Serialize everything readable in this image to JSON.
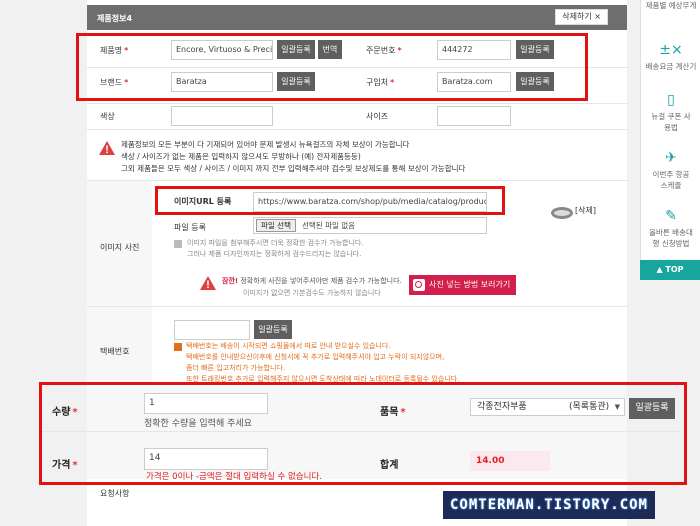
{
  "section": {
    "title": "제품정보4",
    "delete_label": "삭제하기"
  },
  "product": {
    "name_label": "제품명",
    "name_value": "Encore, Virtuoso & Preciso r",
    "bulk_btn": "일괄등록",
    "translate_btn": "번역",
    "order_no_label": "주문번호",
    "order_no_value": "444272",
    "brand_label": "브랜드",
    "brand_value": "Baratza",
    "shop_label": "구입처",
    "shop_value": "Baratza.com",
    "color_label": "색상",
    "size_label": "사이즈"
  },
  "notice": {
    "line1": "제품정보의 모든 부분이 다 기재되어 있어야 문제 발생시 뉴욕걸즈의 자체 보상이 가능합니다",
    "line2": "색상 / 사이즈가 없는 제품은 입력하지 않으셔도 무방하나 (예) 전자제품등등)",
    "line3": "그외 제품들은 모두 색상 / 사이즈 / 이미지 까지 전부 입력해주셔야 검수및 보상제도를 통해 보상이 가능합니다"
  },
  "image": {
    "section_label": "이미지 사진",
    "url_label": "이미지URL 등록",
    "url_value": "https://www.baratza.com/shop/pub/media/catalog/product/ca",
    "file_label": "파일 등록",
    "file_btn": "파일 선택",
    "file_status": "선택된 파일 없음",
    "delete_link": "[삭제]",
    "hint1": "이미지 파일을 첨부해주시면 더욱 정확한 검수가 가능합니다.",
    "hint2": "그러나 제품 디자인까지는 정확하게 검수드리지는 않습니다.",
    "warn_bold": "잠깐!",
    "warn1": "정확하게 사진을 넣어주셔야만 제품 검수가 가능합니다.",
    "warn2": "이미지가 없으면 기본검수도 가능하지 않습니다",
    "how_btn": "사진 넣는 방법 보러가기"
  },
  "tracking": {
    "label": "택배번호",
    "bulk_btn": "일괄등록",
    "lines": [
      "택배번호는 배송이 시작되면 쇼핑몰에서 따로 안내 받으실수 있습니다.",
      "택배번호를 안내받으신이후에 신청서에 꼭 추가로 입력해주셔야 입고 누락이 되지않으며,",
      "좀더 빠른 입고처리가 가능합니다.",
      "또한 트래킹번호 추가로 입력해주지 않으시면 도착상태에 따라 노데이터로 등록될수 있습니다."
    ]
  },
  "qty": {
    "label": "수량",
    "value": "1",
    "hint": "정확한 수량을 입력해 주세요"
  },
  "category": {
    "label": "품목",
    "selected": "각종전자부품",
    "tag": "(목록통관)",
    "bulk_btn": "일괄등록"
  },
  "price": {
    "label": "가격",
    "value": "14",
    "warning": "가격은 0이나 -금액은 절대 입력하실 수 없습니다."
  },
  "total": {
    "label": "합계",
    "value": "14.00"
  },
  "request": {
    "label": "요청사항"
  },
  "sidebar": {
    "items": [
      "제품별 예상무게",
      "배송요금 계산기",
      "뉴걸 쿠폰 사용법",
      "이번주 항공스케쥴",
      "올바른 배송대행 신청방법"
    ],
    "top_label": "TOP"
  },
  "watermark": "COMTERMAN.TISTORY.COM",
  "colors": {
    "accent_red": "#e31212",
    "pink": "#d21f4b",
    "teal": "#18a59d",
    "header_gray": "#6e6e6e"
  }
}
